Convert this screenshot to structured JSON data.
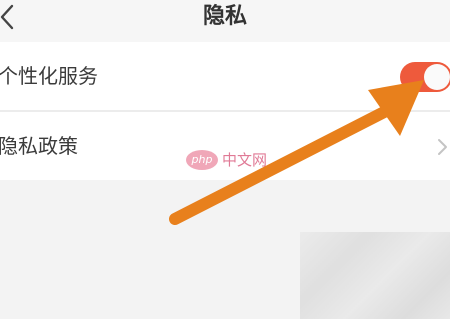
{
  "header": {
    "title": "隐私",
    "back_icon": "chevron-left-icon"
  },
  "settings": [
    {
      "label": "个性化服务",
      "control": "toggle",
      "enabled": true
    },
    {
      "label": "隐私政策",
      "control": "chevron-right-icon"
    }
  ],
  "watermark": {
    "logo_text": "php",
    "text": "中文网"
  },
  "colors": {
    "toggle_on": "#ee5a3c",
    "arrow": "#e8801c",
    "background": "#f3f3f3"
  }
}
